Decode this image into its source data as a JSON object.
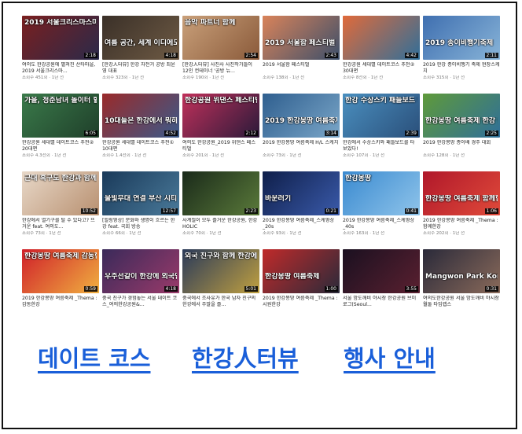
{
  "videos": [
    {
      "caption": "2019 서울크리스마스마켓",
      "title": "여의도 한강공원에 펼쳐진 산타마을, 2019 서울크리스마...",
      "meta": "조회수 451회 · 1년 전",
      "duration": "2:18",
      "bg1": "#7a1f1f",
      "bg2": "#2a2a4a"
    },
    {
      "caption": "여름 공간, 세계 이디에도 없어",
      "title": "[한강人터뷰] 한강 자전거 공방 최윤영 대표",
      "meta": "조회수 323회 · 1년 전",
      "duration": "4:18",
      "bg1": "#3a3028",
      "bg2": "#6e5a44"
    },
    {
      "caption": "음악 파트너 함께",
      "title": "[한강人터뷰] 사진사 사진작가들이 12인 컨테이너 '공방 뉴...",
      "meta": "조회수 190회 · 1년 전",
      "duration": "2:54",
      "bg1": "#c9a07a",
      "bg2": "#8a5a3a"
    },
    {
      "caption": "2019 서울함 페스티벌",
      "title": "2019 서울함 페스티벌",
      "meta": "조회수 138회 · 1년 전",
      "duration": "2:43",
      "bg1": "#d9835a",
      "bg2": "#3c4f6a"
    },
    {
      "caption": "",
      "title": "한강공원 세대별 데이트코스 추천② 30대편",
      "meta": "조회수 8천회 · 1년 전",
      "duration": "4:42",
      "bg1": "#e06a3a",
      "bg2": "#2f6f9a"
    },
    {
      "caption": "2019 종이비행기축제",
      "title": "2019 한강 종이비행기 축제 현장스케치",
      "meta": "조회수 315회 · 1년 전",
      "duration": "2:11",
      "bg1": "#3f6fb0",
      "bg2": "#88b4d8"
    },
    {
      "caption": "가을, 청춘남녀 놀이터 할 만큼",
      "title": "한강공원 세대별 데이트코스 추천② 20대편",
      "meta": "조회수 4.3천회 · 1년 전",
      "duration": "6:05",
      "bg1": "#3a7a4a",
      "bg2": "#1f3f2a"
    },
    {
      "caption": "10대들은 한강에서 뭐하고 놀까?",
      "title": "한강공원 세대별 데이트코스 추천① 10대편",
      "meta": "조회수 1.4천회 · 1년 전",
      "duration": "4:52",
      "bg1": "#9a2a2a",
      "bg2": "#3a5a8a"
    },
    {
      "caption": "한강공원 위댄스 페스티벌",
      "title": "여의도 한강공원_2019 위댄스 페스티벌",
      "meta": "조회수 201회 · 1년 전",
      "duration": "2:12",
      "bg1": "#c0305a",
      "bg2": "#2a1a3a"
    },
    {
      "caption": "2019 한강몽땅 여름축제",
      "title": "2019 한강몽땅 여름축제 H/L 스케치",
      "meta": "조회수 73회 · 1년 전",
      "duration": "3:14",
      "bg1": "#2f5f8f",
      "bg2": "#7aa6c8"
    },
    {
      "caption": "한강 수상스키 패들보드 타봤어요",
      "title": "한강에서 수상스키와 패들보드를 타 보았다!",
      "meta": "조회수 107회 · 1년 전",
      "duration": "2:39",
      "bg1": "#4a8fbf",
      "bg2": "#2a4f7a"
    },
    {
      "caption": "한강몽땅 여름축제 한강 종이배 경주 대회",
      "title": "2019 한강몽땅 종이배 경주 대회",
      "meta": "조회수 128회 · 1년 전",
      "duration": "2:25",
      "bg1": "#5f9a3a",
      "bg2": "#2f6f9a"
    },
    {
      "caption": "근대 흑구도 한강과 함께하는",
      "title": "한강에서 열기구를 탈 수 있다고? 뜨거운 feat. 여의도...",
      "meta": "조회수 73회 · 1년 전",
      "duration": "10:52",
      "bg1": "#e8d8c8",
      "bg2": "#b89070"
    },
    {
      "caption": "물빛무대 연결 부산 시티 투어",
      "title": "[힐링영상] 문화와 생명이 흐르는 한강 feat. 국회 방송",
      "meta": "조회수 66회 · 1년 전",
      "duration": "12:57",
      "bg1": "#1a3a5a",
      "bg2": "#4a7a9a"
    },
    {
      "caption": "",
      "title": "사계절이 모두 즐거운 한강공원, 한강 HOLIC",
      "meta": "조회수 70회 · 1년 전",
      "duration": "2:23",
      "bg1": "#1a2a1a",
      "bg2": "#5a7a3a"
    },
    {
      "caption": "바운러기",
      "title": "2019 한강몽땅 여름축제_스케영상_20s",
      "meta": "조회수 93회 · 1년 전",
      "duration": "0:21",
      "bg1": "#0f1f4a",
      "bg2": "#3a5aaa"
    },
    {
      "caption": "한강몽땅",
      "title": "2019 한강몽땅 여름축제_스케영상_40s",
      "meta": "조회수 163회 · 1년 전",
      "duration": "0:41",
      "bg1": "#3a8ad0",
      "bg2": "#8fc4ea"
    },
    {
      "caption": "한강몽땅 여름축제 함께한강",
      "title": "2019 한강몽땅 여름축제 _Thema : 함께한강",
      "meta": "조회수 202회 · 1년 전",
      "duration": "1:06",
      "bg1": "#b0182a",
      "bg2": "#e04a3a"
    },
    {
      "caption": "한강몽땅 여름축제 감동한강",
      "title": "2019 한강몽땅 여름축제 _Thema : 감동한강",
      "meta": "",
      "duration": "0:59",
      "bg1": "#d0202a",
      "bg2": "#f0b040"
    },
    {
      "caption": "우주선같이 한강에 외국인 친구와",
      "title": "중국 친구가 경험놓는 서울 데이트 코스_여의한강공원&...",
      "meta": "",
      "duration": "4:18",
      "bg1": "#3a2a5a",
      "bg2": "#9a3a6a"
    },
    {
      "caption": "외국 친구와 함께 한강에 빠져보자!",
      "title": "중국에서 조사유가 한국 남자 친구의 한강에서 주말을 즐...",
      "meta": "",
      "duration": "5:01",
      "bg1": "#2a3a5a",
      "bg2": "#c0a040"
    },
    {
      "caption": "한강몽땅 여름축제",
      "title": "2019 한강몽땅 여름축제 _Thema : 시원한강",
      "meta": "",
      "duration": "1:00",
      "bg1": "#c02a2a",
      "bg2": "#2a2a3a"
    },
    {
      "caption": "",
      "title": "서울 밤도깨비 야시장 한강공원 브이로그(Seoul...",
      "meta": "",
      "duration": "3:55",
      "bg1": "#1a1020",
      "bg2": "#5a2030"
    },
    {
      "caption": "Mangwon Park Korean-Wooyon",
      "title": "여의도한강공원 서울 밤도깨비 야시장 월둘 타임랩스",
      "meta": "",
      "duration": "0:31",
      "bg1": "#2a2a3a",
      "bg2": "#8a6a5a"
    }
  ],
  "links": [
    {
      "label": "데이트 코스"
    },
    {
      "label": "한강人터뷰"
    },
    {
      "label": "행사 안내"
    }
  ]
}
